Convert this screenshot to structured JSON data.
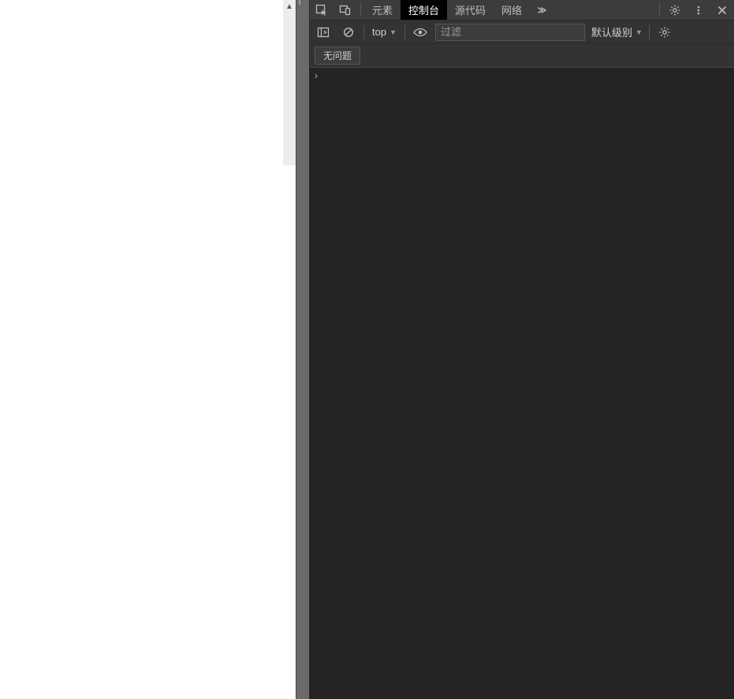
{
  "tabs": {
    "elements": "元素",
    "console": "控制台",
    "sources": "源代码",
    "network": "网络"
  },
  "toolbar": {
    "context": "top",
    "filter_placeholder": "过滤",
    "level": "默认级别"
  },
  "issues": {
    "none": "无问题"
  }
}
